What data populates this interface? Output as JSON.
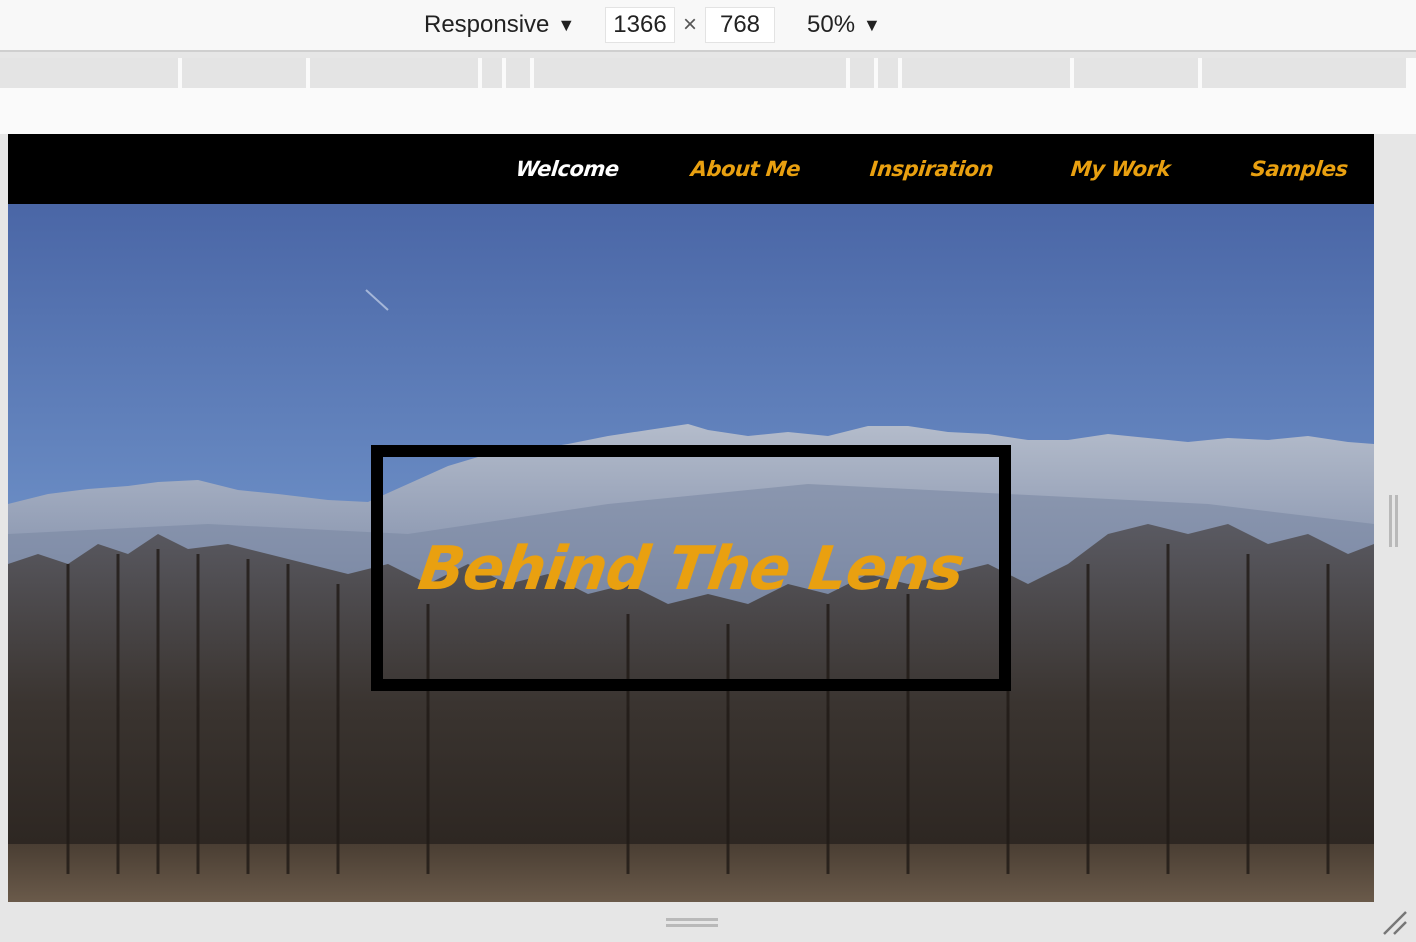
{
  "toolbar": {
    "device": "Responsive",
    "width": "1366",
    "height": "768",
    "times": "×",
    "zoom": "50%",
    "dropdown_arrow": "▼"
  },
  "nav": {
    "items": [
      {
        "label": "Welcome",
        "active": true
      },
      {
        "label": "About Me",
        "active": false
      },
      {
        "label": "Inspiration",
        "active": false
      },
      {
        "label": "My Work",
        "active": false
      },
      {
        "label": "Samples",
        "active": false
      }
    ]
  },
  "hero": {
    "title": "Behind The Lens"
  },
  "colors": {
    "accent": "#e9a010",
    "active": "#ffffff",
    "nav_bg": "#000000",
    "sky_top": "#4b6aab",
    "sky_bottom": "#7d9cc8"
  },
  "icons": {
    "dropdown": "caret-down-icon",
    "close": "times-icon",
    "resize": "resize-corner-icon"
  }
}
